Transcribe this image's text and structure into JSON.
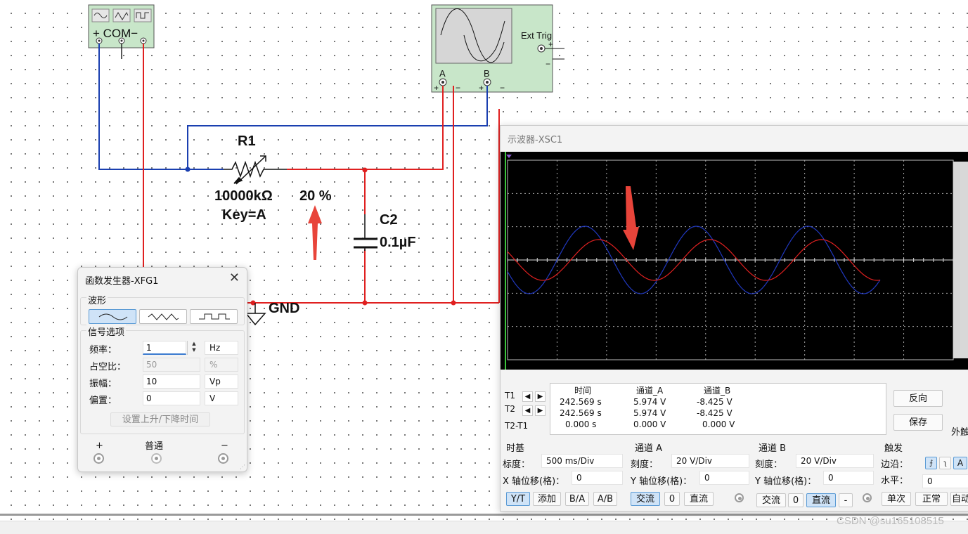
{
  "circuit": {
    "generator_terminals": "+ COM−",
    "scope_ext_trig": "Ext Trig",
    "scope_ext_plus": "+",
    "scope_ext_minus": "−",
    "scope_ch_a": "A",
    "scope_ch_b": "B",
    "scope_term_plus": "+",
    "scope_term_minus": "−",
    "resistor_name": "R1",
    "resistor_value": "10000kΩ",
    "resistor_key": "Key=A",
    "resistor_percent": "20 %",
    "capacitor_name": "C2",
    "capacitor_value": "0.1µF",
    "ground_label": "GND",
    "accent_red": "#e8443a",
    "wire_red": "#e02020",
    "wire_blue": "#1a3fb0"
  },
  "generator": {
    "title": "函数发生器-XFG1",
    "close_glyph": "✕",
    "waveform_group": "波形",
    "waveforms": [
      "sine",
      "triangle",
      "square"
    ],
    "selected_waveform": "sine",
    "signal_group": "信号选项",
    "frequency_label": "频率：",
    "frequency_value": "1",
    "frequency_unit": "Hz",
    "duty_label": "占空比：",
    "duty_value": "50",
    "duty_unit": "%",
    "amplitude_label": "振幅：",
    "amplitude_value": "10",
    "amplitude_unit": "Vp",
    "offset_label": "偏置：",
    "offset_value": "0",
    "offset_unit": "V",
    "rise_fall_button": "设置上升/下降时间",
    "plus_label": "+",
    "common_label": "普通",
    "minus_label": "−"
  },
  "scope": {
    "title": "示波器-XSC1",
    "readout": {
      "col_time": "时间",
      "col_ch_a": "通道_A",
      "col_ch_b": "通道_B",
      "t1_label": "T1",
      "t2_label": "T2",
      "diff_label": "T2-T1",
      "t1_time": "242.569 s",
      "t1_a": "5.974 V",
      "t1_b": "-8.425 V",
      "t2_time": "242.569 s",
      "t2_a": "5.974 V",
      "t2_b": "-8.425 V",
      "d_time": "0.000 s",
      "d_a": "0.000 V",
      "d_b": "0.000 V"
    },
    "reverse_button": "反向",
    "save_button": "保存",
    "external_label": "外触",
    "timebase": {
      "group": "时基",
      "scale_label": "标度：",
      "scale_value": "500 ms/Div",
      "xpos_label": "X 轴位移(格)：",
      "xpos_value": "0",
      "modes": [
        "Y/T",
        "添加",
        "B/A",
        "A/B"
      ],
      "selected_mode": "Y/T"
    },
    "channel_a": {
      "group": "通道 A",
      "scale_label": "刻度：",
      "scale_value": "20  V/Div",
      "ypos_label": "Y 轴位移(格)：",
      "ypos_value": "0",
      "coupling": [
        "交流",
        "0",
        "直流"
      ],
      "selected_coupling": "交流",
      "color": "#e02020"
    },
    "channel_b": {
      "group": "通道 B",
      "scale_label": "刻度：",
      "scale_value": "20  V/Div",
      "ypos_label": "Y 轴位移(格)：",
      "ypos_value": "0",
      "coupling": [
        "交流",
        "0",
        "直流",
        "-"
      ],
      "selected_coupling": "直流",
      "color": "#2038c0"
    },
    "trigger": {
      "group": "触发",
      "edge_label": "边沿：",
      "edge_a": "A",
      "level_label": "水平：",
      "level_value": "0",
      "modes": [
        "单次",
        "正常",
        "自动"
      ]
    }
  },
  "watermark": "CSDN @su165108515"
}
